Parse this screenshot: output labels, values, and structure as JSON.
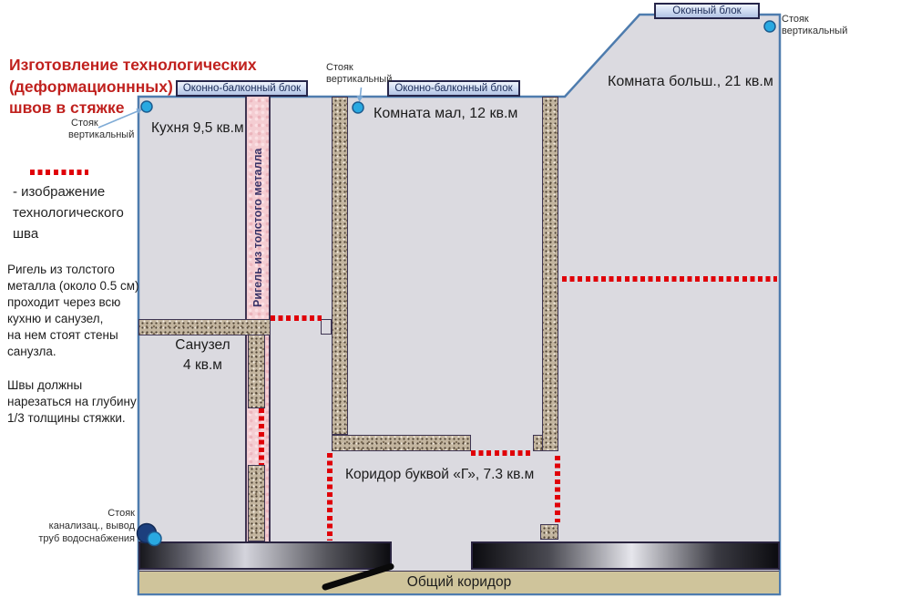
{
  "annotations": {
    "title_lines": [
      "Изготовление технологических",
      "(деформационнных)",
      "швов в стяжке"
    ],
    "legend_lines": [
      "- изображение",
      "технологического",
      "шва"
    ],
    "note_rigel_lines": [
      "Ригель из толстого",
      "металла (около 0.5 см)",
      "проходит через всю",
      "кухню и санузел,",
      "на нем стоят стены",
      "санузла."
    ],
    "note_joints_lines": [
      "Швы должны",
      "нарезаться на глубину",
      "1/3 толщины стяжки."
    ]
  },
  "plan": {
    "rooms": {
      "kitchen": "Кухня 9,5 кв.м",
      "small_room": "Комната мал, 12 кв.м",
      "big_room": "Комната больш., 21 кв.м",
      "bathroom_lines": [
        "Санузел",
        "4 кв.м"
      ],
      "corridor": "Коридор буквой «Г», 7.3 кв.м",
      "common_corridor": "Общий коридор"
    },
    "labels": {
      "window_balcony_block": "Оконно-балконный блок",
      "window_block": "Оконный блок",
      "rigel_strip": "Ригель из толстого металла"
    },
    "risers": {
      "vertical_lines": [
        "Стояк",
        "вертикальный"
      ],
      "sewer_lines": [
        "Стояк",
        "канализац., вывод",
        "труб водоснабжения"
      ]
    }
  },
  "colors": {
    "accent_red": "#c0211e",
    "joint_dot_red": "#e00008",
    "plan_fill": "#dbdae0",
    "plan_border": "#4e7cae",
    "wall_fill": "#c3b59f",
    "rigel_pink": "#f4cdd2",
    "riser_blue": "#29a9e1",
    "sewer_navy": "#1c3f7d",
    "corridor_beige": "#cfc49b"
  }
}
